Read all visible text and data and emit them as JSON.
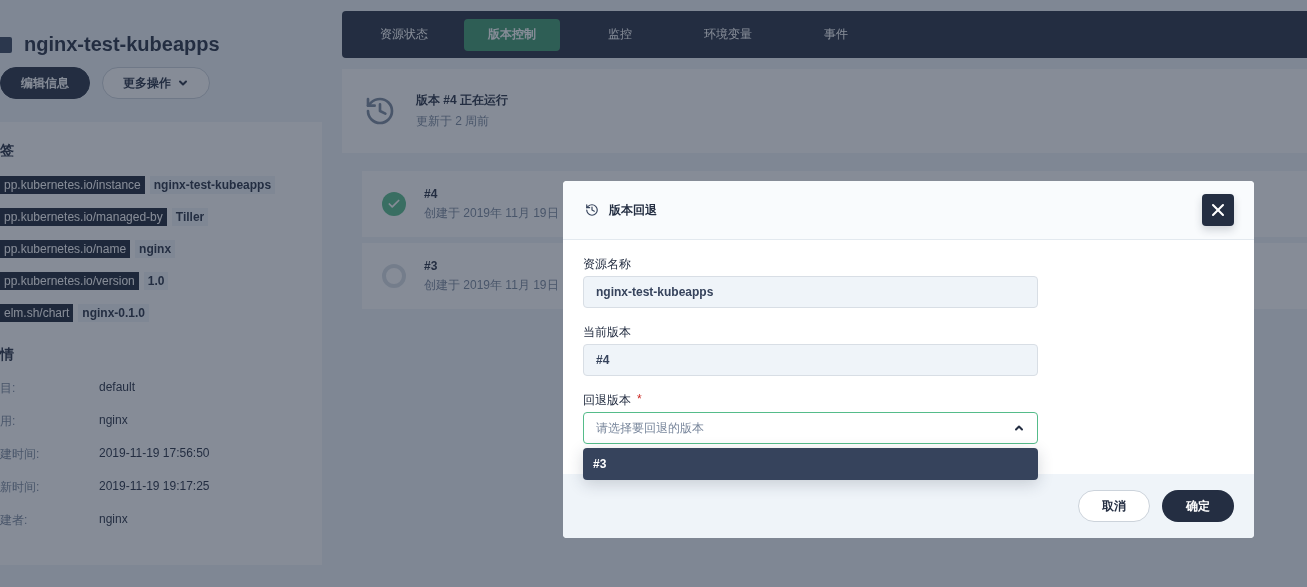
{
  "resource": {
    "title": "nginx-test-kubeapps",
    "buttons": [
      {
        "label": "编辑信息",
        "kind": "primary"
      },
      {
        "label": "更多操作",
        "kind": "dropdown"
      }
    ]
  },
  "labels_section": {
    "heading": "签",
    "labels": [
      {
        "key": "pp.kubernetes.io/instance",
        "value": "nginx-test-kubeapps"
      },
      {
        "key": "pp.kubernetes.io/managed-by",
        "value": "Tiller"
      },
      {
        "key": "pp.kubernetes.io/name",
        "value": "nginx"
      },
      {
        "key": "pp.kubernetes.io/version",
        "value": "1.0"
      },
      {
        "key": "elm.sh/chart",
        "value": "nginx-0.1.0"
      }
    ]
  },
  "details_section": {
    "heading": "情",
    "rows": [
      {
        "label": "目:",
        "value": "default"
      },
      {
        "label": "用:",
        "value": "nginx"
      },
      {
        "label": "建时间:",
        "value": "2019-11-19 17:56:50"
      },
      {
        "label": "新时间:",
        "value": "2019-11-19 19:17:25"
      },
      {
        "label": "建者:",
        "value": "nginx"
      }
    ]
  },
  "tabs": [
    {
      "label": "资源状态",
      "selected": false
    },
    {
      "label": "版本控制",
      "selected": true
    },
    {
      "label": "监控",
      "selected": false
    },
    {
      "label": "环境变量",
      "selected": false
    },
    {
      "label": "事件",
      "selected": false
    }
  ],
  "current": {
    "title": "版本 #4 正在运行",
    "subtitle": "更新于 2 周前"
  },
  "revisions": [
    {
      "name": "#4",
      "created": "创建于 2019年 11月 19日",
      "active": true
    },
    {
      "name": "#3",
      "created": "创建于 2019年 11月 19日",
      "active": false
    }
  ],
  "dialog": {
    "title": "版本回退",
    "fields": [
      {
        "kind": "readonly",
        "label": "资源名称",
        "value": "nginx-test-kubeapps"
      },
      {
        "kind": "readonly",
        "label": "当前版本",
        "value": "#4"
      },
      {
        "kind": "select",
        "label": "回退版本",
        "required": true,
        "required_mark": "*",
        "placeholder": "请选择要回退的版本",
        "expanded": true,
        "options": [
          {
            "label": "#3",
            "highlighted": true
          }
        ]
      }
    ],
    "buttons": [
      {
        "label": "取消",
        "kind": "secondary"
      },
      {
        "label": "确定",
        "kind": "primary"
      }
    ]
  }
}
